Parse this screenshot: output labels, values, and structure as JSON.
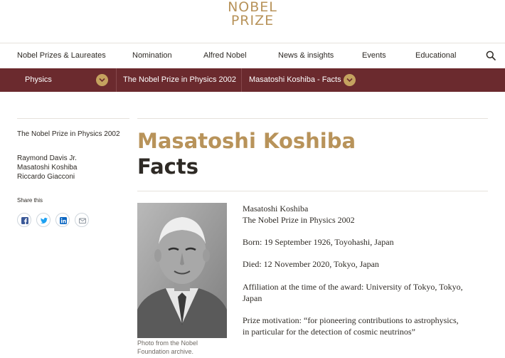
{
  "logo": {
    "line1": "NOBEL",
    "line2": "PRIZE"
  },
  "nav": {
    "items": [
      "Nobel Prizes & Laureates",
      "Nomination",
      "Alfred Nobel",
      "News & insights",
      "Events",
      "Educational"
    ]
  },
  "subnav": {
    "category": "Physics",
    "prize": "The Nobel Prize in Physics 2002",
    "current": "Masatoshi Koshiba - Facts"
  },
  "sidebar": {
    "prize_link": "The Nobel Prize in Physics 2002",
    "laureates": [
      "Raymond Davis Jr.",
      "Masatoshi Koshiba",
      "Riccardo Giacconi"
    ],
    "share_label": "Share this"
  },
  "main": {
    "name": "Masatoshi Koshiba",
    "subtitle": "Facts",
    "photo_caption": "Photo from the Nobel Foundation archive.",
    "facts": {
      "name": "Masatoshi Koshiba",
      "prize": "The Nobel Prize in Physics 2002",
      "born": "Born: 19 September 1926, Toyohashi, Japan",
      "died": "Died: 12 November 2020, Tokyo, Japan",
      "affiliation": "Affiliation at the time of the award: University of Tokyo, Tokyo, Japan",
      "motivation": "Prize motivation: “for pioneering contributions to astrophysics, in particular for the detection of cosmic neutrinos”"
    }
  },
  "colors": {
    "gold": "#b8935a",
    "maroon": "#6b2a2e",
    "chevron": "#c5a25f",
    "text": "#2e2a25"
  }
}
